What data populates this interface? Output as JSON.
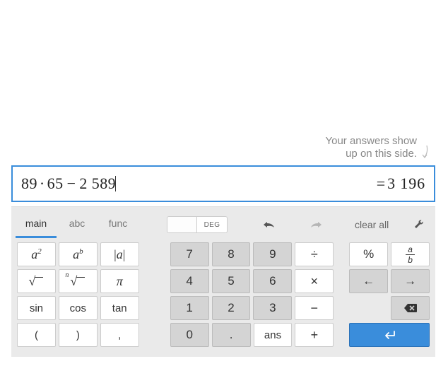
{
  "hint": {
    "line1": "Your answers show",
    "line2": "up on this side."
  },
  "input": {
    "expression_parts": {
      "a": "89",
      "b": "65",
      "c": "2 589"
    },
    "result": "3 196"
  },
  "tabs": {
    "main": "main",
    "abc": "abc",
    "func": "func"
  },
  "mode": {
    "blank": "",
    "deg": "DEG"
  },
  "toolbar": {
    "clear_all": "clear all"
  },
  "keys": {
    "d7": "7",
    "d8": "8",
    "d9": "9",
    "d4": "4",
    "d5": "5",
    "d6": "6",
    "d1": "1",
    "d2": "2",
    "d3": "3",
    "d0": "0",
    "dot": ".",
    "ans": "ans",
    "div": "÷",
    "mul": "×",
    "sub": "−",
    "add": "+",
    "pct": "%",
    "left": "←",
    "right": "→",
    "pi": "π",
    "sin": "sin",
    "cos": "cos",
    "tan": "tan",
    "lpar": "(",
    "rpar": ")",
    "comma": ",",
    "frac_n": "a",
    "frac_d": "b",
    "abs": "a",
    "sq_base": "a",
    "sq_exp": "2",
    "pow_base": "a",
    "pow_exp": "b",
    "sqrt": "√",
    "nroot": "√",
    "nroot_n": "n",
    "enter": "↵"
  }
}
